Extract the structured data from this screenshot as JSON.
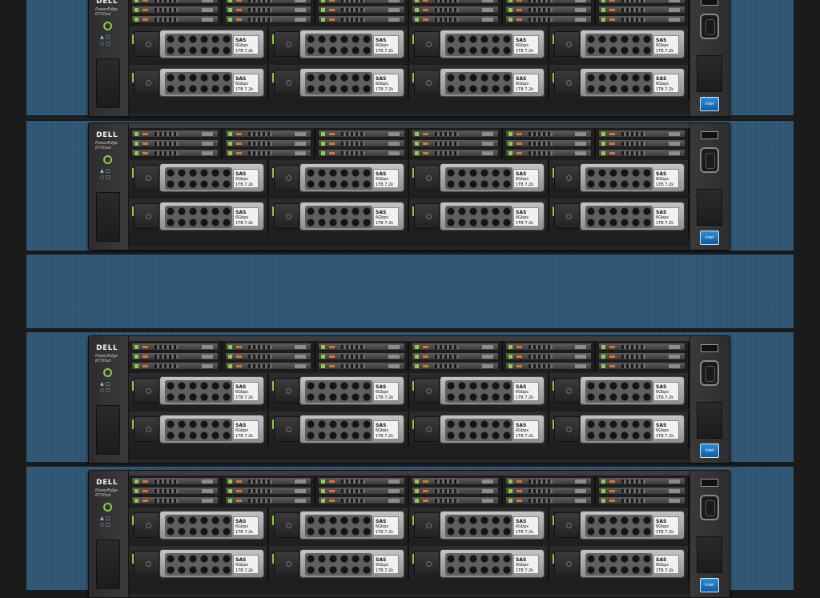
{
  "servers": [
    {
      "brand": "DELL",
      "model": "PowerEdge R730xd",
      "intel_badge": "intel",
      "small_drives_per_group": 3,
      "drive_groups": 6,
      "large_drive_rows": 2,
      "drive_label": {
        "type": "SAS",
        "subtype": "6Gbps",
        "capacity": "1TB 7.2k"
      }
    }
  ],
  "colors": {
    "rack_bay": "#2e5673",
    "server_body": "#2f2f2f",
    "activity_led": "#8ecf3f",
    "status_led": "#e0732a",
    "drive_carrier": "#aaaaaa"
  },
  "icons": [
    "power-icon",
    "usb-port-icon",
    "vga-port-icon",
    "intel-badge-icon",
    "drive-latch-icon"
  ]
}
